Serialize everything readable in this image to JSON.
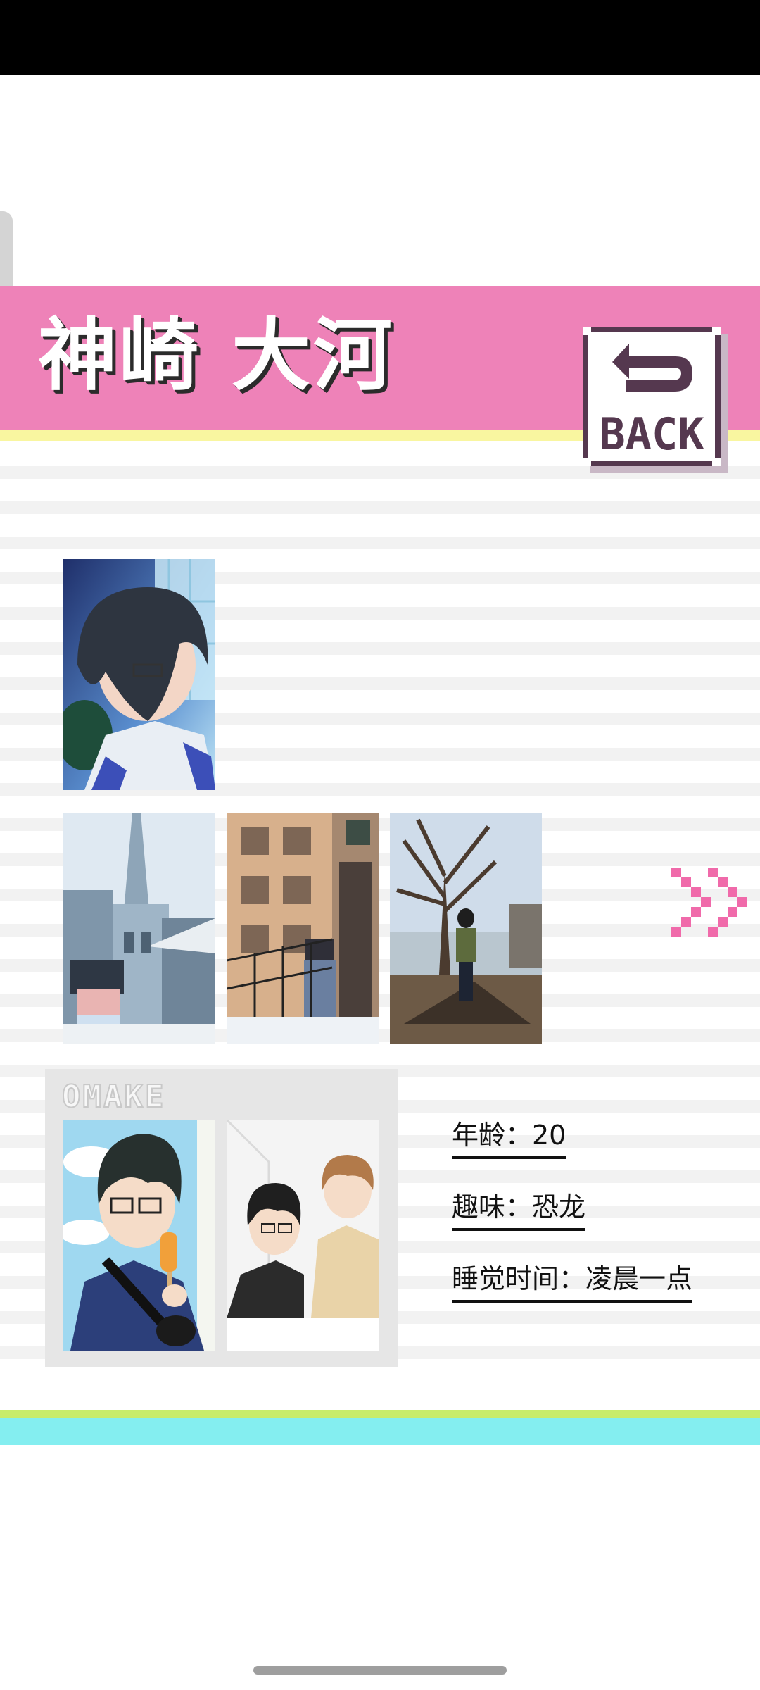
{
  "profile": {
    "name": "神崎 大河",
    "back_button_label": "BACK",
    "info": {
      "age": "年龄：20",
      "hobby": "趣味：恐龙",
      "sleep_time": "睡觉时间：凌晨一点"
    },
    "omake_label": "OMAKE"
  },
  "icons": {
    "back": "back-arrow-icon",
    "next": "double-chevron-right-icon"
  },
  "colors": {
    "title_band": "#ee82b8",
    "title_underline": "#f9f6a0",
    "accent_pink": "#f06aaa",
    "bottom_green": "#c8ec6a",
    "bottom_cyan": "#84eef0"
  }
}
